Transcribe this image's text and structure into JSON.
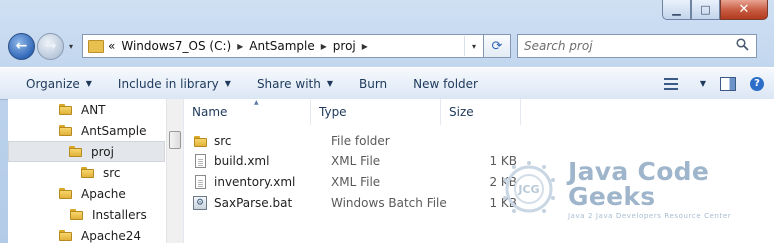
{
  "window": {
    "caption": {
      "minimize": "▁",
      "maximize": "□",
      "close": "✕"
    }
  },
  "nav": {
    "back": "←",
    "forward": "→",
    "dropdown": "▾"
  },
  "address": {
    "overflow": "«",
    "segments": [
      "Windows7_OS (C:)",
      "AntSample",
      "proj"
    ],
    "separator": "▸",
    "dropdown": "▾",
    "refresh": "⟳"
  },
  "search": {
    "placeholder": "Search proj",
    "icon": "🔍"
  },
  "toolbar": {
    "organize": "Organize",
    "include": "Include in library",
    "share": "Share with",
    "burn": "Burn",
    "new_folder": "New folder",
    "caret": "▼",
    "help": "?"
  },
  "tree": {
    "items": [
      {
        "label": "ANT",
        "level": 1
      },
      {
        "label": "AntSample",
        "level": 1
      },
      {
        "label": "proj",
        "level": 2,
        "selected": true
      },
      {
        "label": "src",
        "level": 3
      },
      {
        "label": "Apache",
        "level": 1
      },
      {
        "label": "Installers",
        "level": 2
      },
      {
        "label": "Apache24",
        "level": 1
      }
    ]
  },
  "columns": {
    "name": "Name",
    "type": "Type",
    "size": "Size",
    "sort_glyph": "▲"
  },
  "files": [
    {
      "name": "src",
      "type": "File folder",
      "size": "",
      "icon": "folder-icon"
    },
    {
      "name": "build.xml",
      "type": "XML File",
      "size": "1 KB",
      "icon": "xml-file-icon"
    },
    {
      "name": "inventory.xml",
      "type": "XML File",
      "size": "2 KB",
      "icon": "xml-file-icon"
    },
    {
      "name": "SaxParse.bat",
      "type": "Windows Batch File",
      "size": "1 KB",
      "icon": "batch-file-icon"
    }
  ],
  "watermark": {
    "title": "Java Code Geeks",
    "subtitle": "Java 2 Java Developers Resource Center",
    "logo_text": "JCG"
  }
}
